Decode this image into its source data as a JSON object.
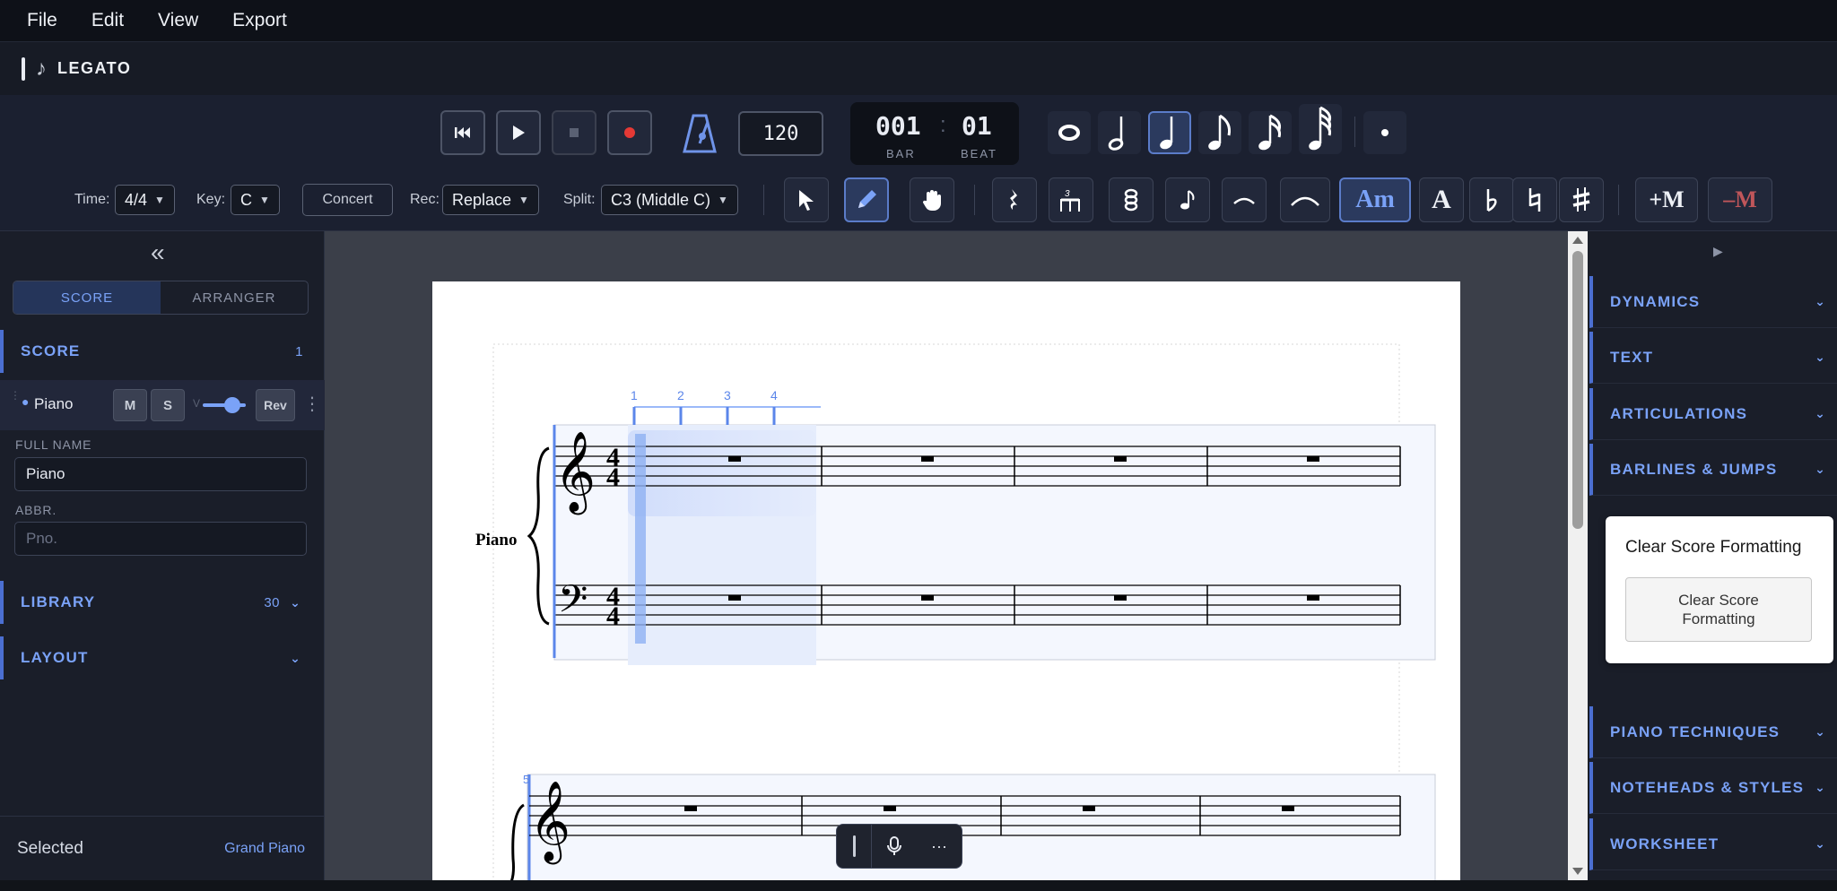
{
  "menu": {
    "file": "File",
    "edit": "Edit",
    "view": "View",
    "export": "Export"
  },
  "app": {
    "title": "LEGATO"
  },
  "transport": {
    "tempo": "120",
    "bar": "001",
    "beat": "01",
    "bar_label": "BAR",
    "beat_label": "BEAT",
    "record_color": "#e53935"
  },
  "toolbar": {
    "time_label": "Time:",
    "time_value": "4/4",
    "key_label": "Key:",
    "key_value": "C",
    "concert": "Concert",
    "rec_label": "Rec:",
    "rec_value": "Replace",
    "split_label": "Split:",
    "split_value": "C3 (Middle C)",
    "chord_am": "Am",
    "chord_a": "A",
    "add_measure": "+M",
    "remove_measure": "–M"
  },
  "left": {
    "tab_score": "SCORE",
    "tab_arranger": "ARRANGER",
    "score_section": "SCORE",
    "score_count": "1",
    "instrument": "Piano",
    "mute": "M",
    "solo": "S",
    "vol_label": "V",
    "rev": "Rev",
    "full_name_label": "FULL NAME",
    "full_name_value": "Piano",
    "abbr_label": "ABBR.",
    "abbr_placeholder": "Pno.",
    "library": "LIBRARY",
    "library_count": "30",
    "layout": "LAYOUT",
    "selected_label": "Selected",
    "selected_value": "Grand Piano"
  },
  "score": {
    "instrument_label": "Piano",
    "beat_markers": [
      "1",
      "2",
      "3",
      "4"
    ],
    "system2_bar": "5",
    "time_sig_top": "4",
    "time_sig_bottom": "4"
  },
  "right": {
    "sections": [
      {
        "label": "DYNAMICS"
      },
      {
        "label": "TEXT"
      },
      {
        "label": "ARTICULATIONS"
      },
      {
        "label": "BARLINES & JUMPS"
      },
      {
        "label": "PIANO TECHNIQUES"
      },
      {
        "label": "NOTEHEADS & STYLES"
      },
      {
        "label": "WORKSHEET"
      }
    ],
    "popup_title": "Clear Score Formatting",
    "popup_button": "Clear Score Formatting"
  },
  "colors": {
    "accent": "#7aa2f7",
    "highlight": "#5b7cc9",
    "remove": "#c0565a"
  }
}
